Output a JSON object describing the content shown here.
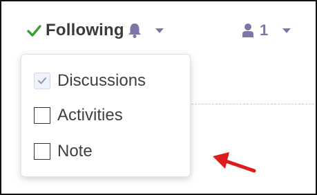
{
  "toolbar": {
    "follow_label": "Following",
    "follow_icon": "check-icon",
    "notify_icon": "bell-icon",
    "members_icon": "user-icon",
    "members_count": "1"
  },
  "menu": {
    "items": [
      {
        "label": "Discussions",
        "checked": true
      },
      {
        "label": "Activities",
        "checked": false
      },
      {
        "label": "Note",
        "checked": false
      }
    ]
  },
  "colors": {
    "check": "#3f9b3a",
    "accent": "#7b78a8",
    "text": "#3a3a3a",
    "annotation_arrow": "#e01b1b"
  }
}
